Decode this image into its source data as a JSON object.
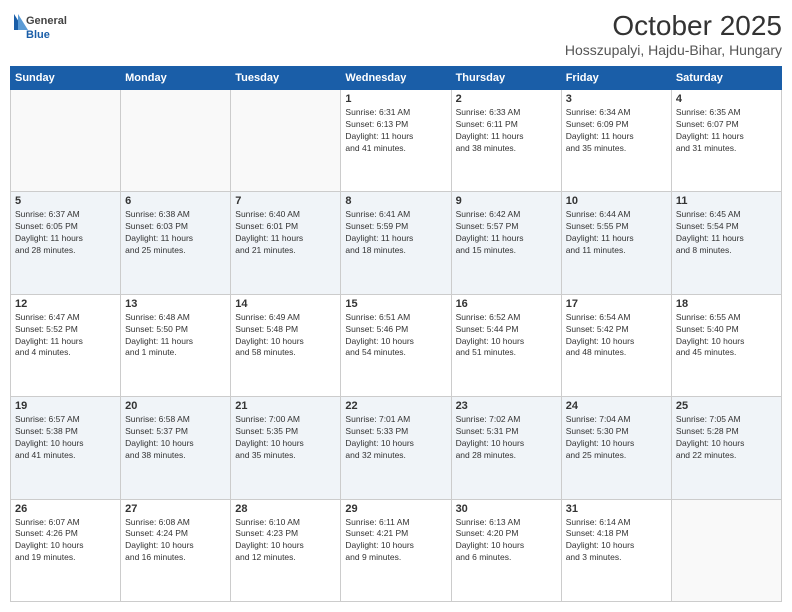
{
  "header": {
    "logo_general": "General",
    "logo_blue": "Blue",
    "month_title": "October 2025",
    "location": "Hosszupalyi, Hajdu-Bihar, Hungary"
  },
  "days_of_week": [
    "Sunday",
    "Monday",
    "Tuesday",
    "Wednesday",
    "Thursday",
    "Friday",
    "Saturday"
  ],
  "weeks": [
    [
      {
        "day": "",
        "content": ""
      },
      {
        "day": "",
        "content": ""
      },
      {
        "day": "",
        "content": ""
      },
      {
        "day": "1",
        "content": "Sunrise: 6:31 AM\nSunset: 6:13 PM\nDaylight: 11 hours\nand 41 minutes."
      },
      {
        "day": "2",
        "content": "Sunrise: 6:33 AM\nSunset: 6:11 PM\nDaylight: 11 hours\nand 38 minutes."
      },
      {
        "day": "3",
        "content": "Sunrise: 6:34 AM\nSunset: 6:09 PM\nDaylight: 11 hours\nand 35 minutes."
      },
      {
        "day": "4",
        "content": "Sunrise: 6:35 AM\nSunset: 6:07 PM\nDaylight: 11 hours\nand 31 minutes."
      }
    ],
    [
      {
        "day": "5",
        "content": "Sunrise: 6:37 AM\nSunset: 6:05 PM\nDaylight: 11 hours\nand 28 minutes."
      },
      {
        "day": "6",
        "content": "Sunrise: 6:38 AM\nSunset: 6:03 PM\nDaylight: 11 hours\nand 25 minutes."
      },
      {
        "day": "7",
        "content": "Sunrise: 6:40 AM\nSunset: 6:01 PM\nDaylight: 11 hours\nand 21 minutes."
      },
      {
        "day": "8",
        "content": "Sunrise: 6:41 AM\nSunset: 5:59 PM\nDaylight: 11 hours\nand 18 minutes."
      },
      {
        "day": "9",
        "content": "Sunrise: 6:42 AM\nSunset: 5:57 PM\nDaylight: 11 hours\nand 15 minutes."
      },
      {
        "day": "10",
        "content": "Sunrise: 6:44 AM\nSunset: 5:55 PM\nDaylight: 11 hours\nand 11 minutes."
      },
      {
        "day": "11",
        "content": "Sunrise: 6:45 AM\nSunset: 5:54 PM\nDaylight: 11 hours\nand 8 minutes."
      }
    ],
    [
      {
        "day": "12",
        "content": "Sunrise: 6:47 AM\nSunset: 5:52 PM\nDaylight: 11 hours\nand 4 minutes."
      },
      {
        "day": "13",
        "content": "Sunrise: 6:48 AM\nSunset: 5:50 PM\nDaylight: 11 hours\nand 1 minute."
      },
      {
        "day": "14",
        "content": "Sunrise: 6:49 AM\nSunset: 5:48 PM\nDaylight: 10 hours\nand 58 minutes."
      },
      {
        "day": "15",
        "content": "Sunrise: 6:51 AM\nSunset: 5:46 PM\nDaylight: 10 hours\nand 54 minutes."
      },
      {
        "day": "16",
        "content": "Sunrise: 6:52 AM\nSunset: 5:44 PM\nDaylight: 10 hours\nand 51 minutes."
      },
      {
        "day": "17",
        "content": "Sunrise: 6:54 AM\nSunset: 5:42 PM\nDaylight: 10 hours\nand 48 minutes."
      },
      {
        "day": "18",
        "content": "Sunrise: 6:55 AM\nSunset: 5:40 PM\nDaylight: 10 hours\nand 45 minutes."
      }
    ],
    [
      {
        "day": "19",
        "content": "Sunrise: 6:57 AM\nSunset: 5:38 PM\nDaylight: 10 hours\nand 41 minutes."
      },
      {
        "day": "20",
        "content": "Sunrise: 6:58 AM\nSunset: 5:37 PM\nDaylight: 10 hours\nand 38 minutes."
      },
      {
        "day": "21",
        "content": "Sunrise: 7:00 AM\nSunset: 5:35 PM\nDaylight: 10 hours\nand 35 minutes."
      },
      {
        "day": "22",
        "content": "Sunrise: 7:01 AM\nSunset: 5:33 PM\nDaylight: 10 hours\nand 32 minutes."
      },
      {
        "day": "23",
        "content": "Sunrise: 7:02 AM\nSunset: 5:31 PM\nDaylight: 10 hours\nand 28 minutes."
      },
      {
        "day": "24",
        "content": "Sunrise: 7:04 AM\nSunset: 5:30 PM\nDaylight: 10 hours\nand 25 minutes."
      },
      {
        "day": "25",
        "content": "Sunrise: 7:05 AM\nSunset: 5:28 PM\nDaylight: 10 hours\nand 22 minutes."
      }
    ],
    [
      {
        "day": "26",
        "content": "Sunrise: 6:07 AM\nSunset: 4:26 PM\nDaylight: 10 hours\nand 19 minutes."
      },
      {
        "day": "27",
        "content": "Sunrise: 6:08 AM\nSunset: 4:24 PM\nDaylight: 10 hours\nand 16 minutes."
      },
      {
        "day": "28",
        "content": "Sunrise: 6:10 AM\nSunset: 4:23 PM\nDaylight: 10 hours\nand 12 minutes."
      },
      {
        "day": "29",
        "content": "Sunrise: 6:11 AM\nSunset: 4:21 PM\nDaylight: 10 hours\nand 9 minutes."
      },
      {
        "day": "30",
        "content": "Sunrise: 6:13 AM\nSunset: 4:20 PM\nDaylight: 10 hours\nand 6 minutes."
      },
      {
        "day": "31",
        "content": "Sunrise: 6:14 AM\nSunset: 4:18 PM\nDaylight: 10 hours\nand 3 minutes."
      },
      {
        "day": "",
        "content": ""
      }
    ]
  ]
}
